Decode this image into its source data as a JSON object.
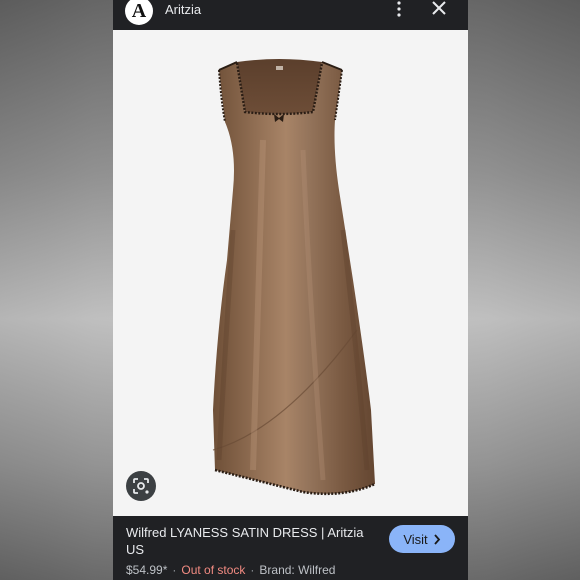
{
  "header": {
    "logo_letter": "A",
    "site_name": "Aritzia",
    "more_icon": "more-vert-icon",
    "close_icon": "close-icon"
  },
  "image": {
    "lens_icon": "lens-search-icon"
  },
  "result": {
    "title": "Wilfred LYANESS SATIN DRESS | Aritzia US",
    "visit_label": "Visit",
    "price": "$54.99*",
    "stock_status": "Out of stock",
    "brand": "Brand: Wilfred",
    "separator": "·"
  },
  "colors": {
    "status_out_of_stock": "#f28b82",
    "visit_button": "#8ab4f8",
    "panel_bg": "#202124"
  }
}
